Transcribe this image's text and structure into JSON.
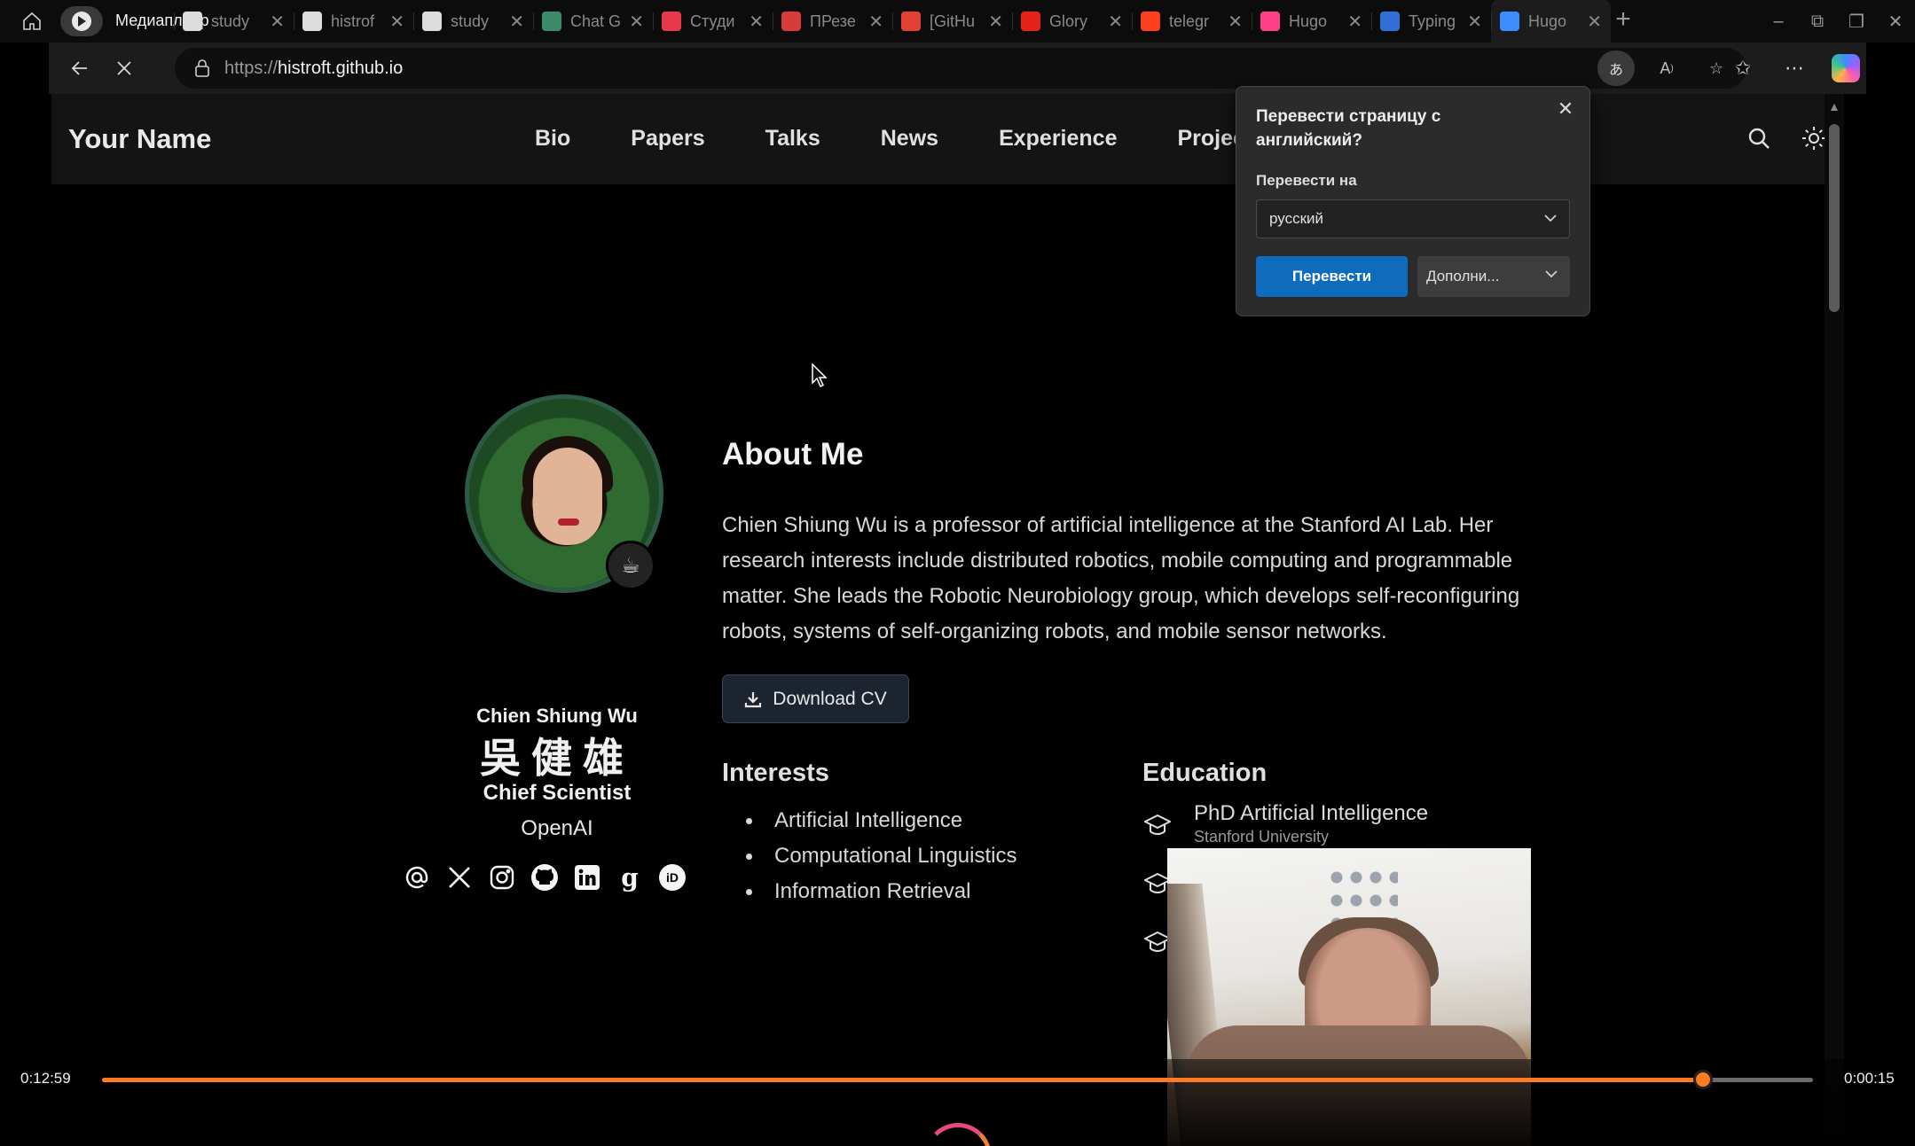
{
  "browser": {
    "media_label": "Медиаплеер",
    "tabs": [
      {
        "title": "study",
        "favicon": "github-icon",
        "color": "#dcdcdc"
      },
      {
        "title": "histrof",
        "favicon": "github-icon",
        "color": "#dcdcdc"
      },
      {
        "title": "study",
        "favicon": "github-icon",
        "color": "#dcdcdc"
      },
      {
        "title": "Chat G",
        "favicon": "chatgpt-icon",
        "color": "#3d8a6b"
      },
      {
        "title": "Студи",
        "favicon": "s-logo-icon",
        "color": "#e8374b"
      },
      {
        "title": "ПРезе",
        "favicon": "r-logo-icon",
        "color": "#d93b3b"
      },
      {
        "title": "[GitHu",
        "favicon": "gmail-icon",
        "color": "#e34133"
      },
      {
        "title": "Glory",
        "favicon": "youtube-icon",
        "color": "#e62117"
      },
      {
        "title": "telegr",
        "favicon": "yandex-icon",
        "color": "#fc3f1d"
      },
      {
        "title": "Hugo",
        "favicon": "h-logo-icon",
        "color": "#ff4088"
      },
      {
        "title": "Typing",
        "favicon": "typing-icon",
        "color": "#2f6fd6"
      },
      {
        "title": "Hugo",
        "favicon": "loading-icon",
        "color": "#3c8cff"
      }
    ],
    "active_tab_index": 11,
    "url_prefix": "https://",
    "url_host": "histroft.github.io"
  },
  "site": {
    "brand": "Your Name",
    "nav": [
      "Bio",
      "Papers",
      "Talks",
      "News",
      "Experience",
      "Projects"
    ]
  },
  "profile": {
    "name": "Chien Shiung Wu",
    "native_name": "吳健雄",
    "role": "Chief Scientist",
    "org": "OpenAI",
    "socials": [
      "at-sign-icon",
      "x-icon",
      "instagram-icon",
      "github-icon",
      "linkedin-icon",
      "google-scholar-icon",
      "orcid-icon"
    ]
  },
  "about": {
    "title": "About Me",
    "bio": "Chien Shiung Wu is a professor of artificial intelligence at the Stanford AI Lab. Her research interests include distributed robotics, mobile computing and programmable matter. She leads the Robotic Neurobiology group, which develops self-reconfiguring robots, systems of self-organizing robots, and mobile sensor networks.",
    "cv_label": "Download CV"
  },
  "interests": {
    "title": "Interests",
    "items": [
      "Artificial Intelligence",
      "Computational Linguistics",
      "Information Retrieval"
    ]
  },
  "education": {
    "title": "Education",
    "items": [
      {
        "degree": "PhD Artificial Intelligence",
        "institution": "Stanford University"
      }
    ]
  },
  "translate_popup": {
    "title": "Перевести страницу с английский?",
    "label": "Перевести на",
    "language": "русский",
    "translate_label": "Перевести",
    "more_label": "Дополни..."
  },
  "player": {
    "elapsed": "0:12:59",
    "remaining": "0:00:15",
    "progress_fraction": 0.9355
  }
}
